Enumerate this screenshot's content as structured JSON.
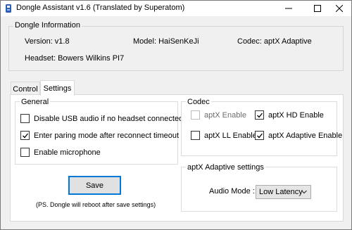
{
  "window": {
    "title": "Dongle Assistant v1.6 (Translated by Superatom)"
  },
  "dongle_info": {
    "group_title": "Dongle Information",
    "version": "Version: v1.8",
    "model": "Model: HaiSenKeJi",
    "codec": "Codec: aptX Adaptive",
    "headset": "Headset: Bowers  Wilkins PI7"
  },
  "tabs": [
    {
      "label": "Control",
      "active": false
    },
    {
      "label": "Settings",
      "active": true
    }
  ],
  "general": {
    "group_title": "General",
    "options": [
      {
        "label": "Disable USB audio if no headset connected",
        "checked": false
      },
      {
        "label": "Enter paring mode after reconnect timeout",
        "checked": true
      },
      {
        "label": "Enable microphone",
        "checked": false
      }
    ]
  },
  "codec_group": {
    "group_title": "Codec",
    "options": [
      {
        "label": "aptX Enable",
        "checked": false,
        "enabled": false
      },
      {
        "label": "aptX HD Enable",
        "checked": true,
        "enabled": true
      },
      {
        "label": "aptX LL Enable",
        "checked": false,
        "enabled": true
      },
      {
        "label": "aptX Adaptive Enable",
        "checked": true,
        "enabled": true
      }
    ]
  },
  "adaptive": {
    "group_title": "aptX Adaptive settings",
    "audio_mode_label": "Audio Mode :",
    "audio_mode_value": "Low Latency"
  },
  "save": {
    "label": "Save",
    "note": "(PS.  Dongle will reboot  after save settings)"
  },
  "colors": {
    "accent": "#0078d7",
    "window_bg": "#f0f0f0",
    "panel_bg": "#ffffff"
  }
}
